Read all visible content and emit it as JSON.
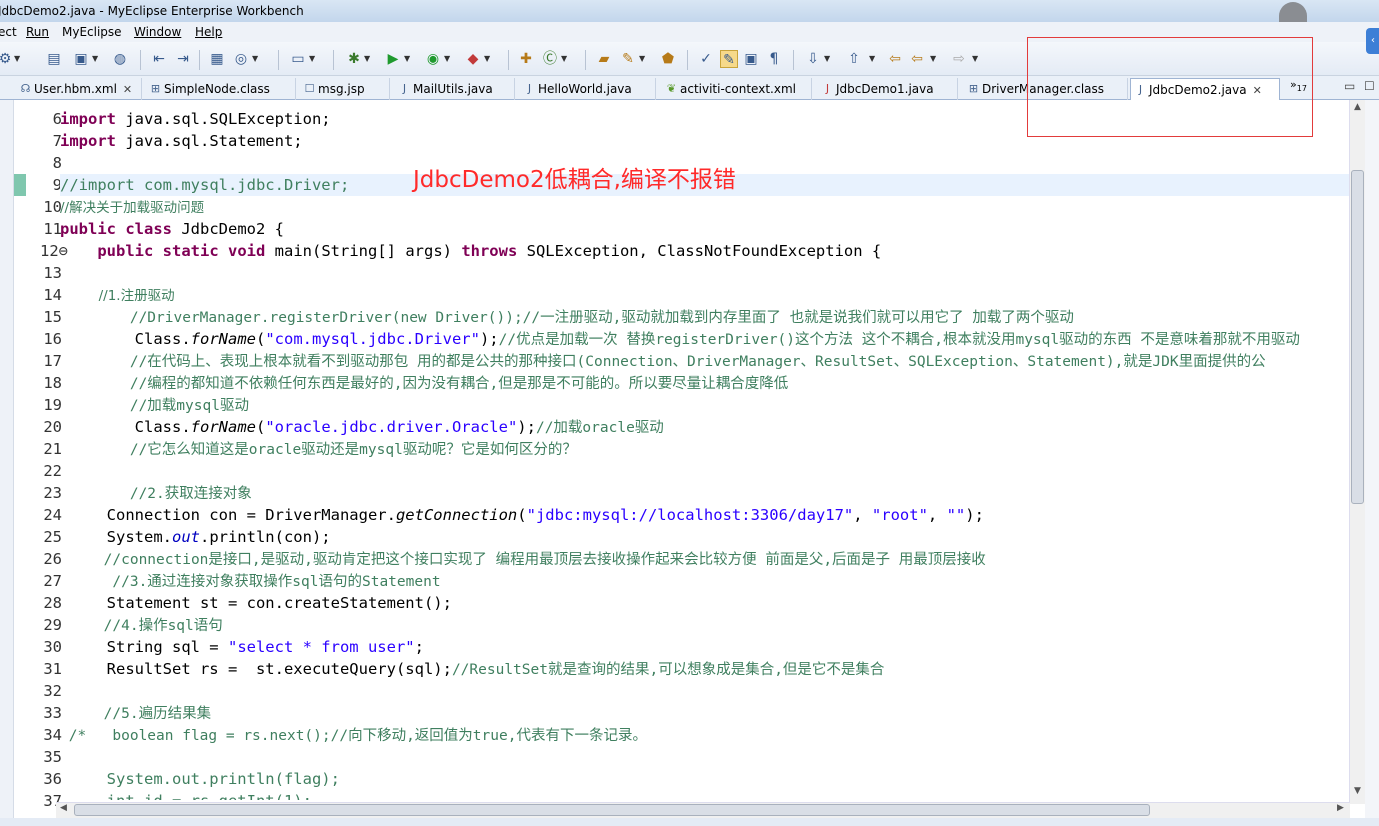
{
  "window": {
    "title": "JdbcDemo2.java - MyEclipse Enterprise Workbench"
  },
  "menu": {
    "items": [
      "ect",
      "Run",
      "MyEclipse",
      "Window",
      "Help"
    ]
  },
  "toolbar": {
    "icons": [
      "ant-icon",
      "new-wizard-icon",
      "globe-icon",
      "back-doc-icon",
      "forward-doc-icon",
      "open-type-icon",
      "server-icon",
      "monitor-icon",
      "debug-icon",
      "run-icon",
      "run-external-icon",
      "coverage-icon",
      "new-class-icon",
      "new-package-icon",
      "open-folder-icon",
      "pin-icon",
      "open-perspective-icon",
      "task-icon",
      "mark-occurrences-icon",
      "block-select-icon",
      "show-whitespace-icon",
      "prev-annotation-icon",
      "next-annotation-icon",
      "last-edit-icon",
      "back-icon",
      "forward-icon"
    ]
  },
  "tabs": [
    {
      "label": "User.hbm.xml",
      "icon": "xml-file-icon",
      "closable": true
    },
    {
      "label": "SimpleNode.class",
      "icon": "class-file-icon"
    },
    {
      "label": "msg.jsp",
      "icon": "jsp-file-icon"
    },
    {
      "label": "MailUtils.java",
      "icon": "java-file-icon"
    },
    {
      "label": "HelloWorld.java",
      "icon": "java-file-icon"
    },
    {
      "label": "activiti-context.xml",
      "icon": "spring-file-icon"
    },
    {
      "label": "JdbcDemo1.java",
      "icon": "java-file-icon"
    },
    {
      "label": "DriverManager.class",
      "icon": "class-file-icon"
    },
    {
      "label": "JdbcDemo2.java",
      "icon": "java-file-icon",
      "active": true,
      "closable": true
    }
  ],
  "tab_overflow": {
    "label": "»",
    "count": "17"
  },
  "annotation": "JdbcDemo2低耦合,编译不报错",
  "line_numbers": [
    "6",
    "7",
    "8",
    "9",
    "10",
    "11",
    "12⊖",
    "13",
    "14",
    "15",
    "16",
    "17",
    "18",
    "19",
    "20",
    "21",
    "22",
    "23",
    "24",
    "25",
    "26",
    "27",
    "28",
    "29",
    "30",
    "31",
    "32",
    "33",
    "34",
    "35",
    "36",
    "37"
  ],
  "code": {
    "l6a": "import",
    "l6b": " java.sql.SQLException;",
    "l7a": "import",
    "l7b": " java.sql.Statement;",
    "l9a": "//",
    "l9b": "import com.mysql.jdbc.Driver;",
    "l10": "//解决关于加载驱动问题",
    "l11a": "public",
    "l11b": " ",
    "l11c": "class",
    "l11d": " JdbcDemo2 {",
    "l12a": "    ",
    "l12b": "public",
    "l12c": " ",
    "l12d": "static",
    "l12e": " ",
    "l12f": "void",
    "l12g": " main(String[] args) ",
    "l12h": "throws",
    "l12i": " SQLException, ClassNotFoundException {",
    "l14": "         //1.注册驱动",
    "l15": "        //DriverManager.registerDriver(new Driver());//一注册驱动,驱动就加载到内存里面了 也就是说我们就可以用它了 加载了两个驱动",
    "l16a": "        Class.",
    "l16b": "forName",
    "l16c": "(",
    "l16d": "\"com.mysql.jdbc.Driver\"",
    "l16e": ");",
    "l16f": "//优点是加载一次 替换registerDriver()这个方法 这个不耦合,根本就没用mysql驱动的东西 不是意味着那就不用驱动",
    "l17": "        //在代码上、表现上根本就看不到驱动那包 用的都是公共的那种接口(Connection、DriverManager、ResultSet、SQLException、Statement),就是JDK里面提供的公",
    "l18": "        //编程的都知道不依赖任何东西是最好的,因为没有耦合,但是那是不可能的。所以要尽量让耦合度降低",
    "l19": "        //加载mysql驱动",
    "l20a": "        Class.",
    "l20b": "forName",
    "l20c": "(",
    "l20d": "\"oracle.jdbc.driver.Oracle\"",
    "l20e": ");",
    "l20f": "//加载oracle驱动",
    "l21": "        //它怎么知道这是oracle驱动还是mysql驱动呢？它是如何区分的？",
    "l23": "        //2.获取连接对象",
    "l24a": "     Connection con = DriverManager.",
    "l24b": "getConnection",
    "l24c": "(",
    "l24d": "\"jdbc:mysql://localhost:3306/day17\"",
    "l24e": ", ",
    "l24f": "\"root\"",
    "l24g": ", ",
    "l24h": "\"\"",
    "l24i": ");",
    "l25a": "     System.",
    "l25b": "out",
    "l25c": ".println(con);",
    "l26": "     //connection是接口,是驱动,驱动肯定把这个接口实现了 编程用最顶层去接收操作起来会比较方便 前面是父,后面是子 用最顶层接收",
    "l27": "      //3.通过连接对象获取操作sql语句的Statement",
    "l28": "     Statement st = con.createStatement();",
    "l29": "     //4.操作sql语句",
    "l30a": "     String sql = ",
    "l30b": "\"select * from user\"",
    "l30c": ";",
    "l31a": "     ResultSet rs =  st.executeQuery(sql);",
    "l31b": "//ResultSet就是查询的结果,可以想象成是集合,但是它不是集合",
    "l33": "     //5.遍历结果集",
    "l34": " /*   boolean flag = rs.next();//向下移动,返回值为true,代表有下一条记录。",
    "l36": "     System.out.println(flag);",
    "l37": "     int id = rs.getInt(1);"
  },
  "colors": {
    "keyword": "#7f0055",
    "comment": "#3f7f5f",
    "string": "#2a00ff",
    "annotation": "#ff2a2a",
    "current_line": "#e8f2fe"
  }
}
